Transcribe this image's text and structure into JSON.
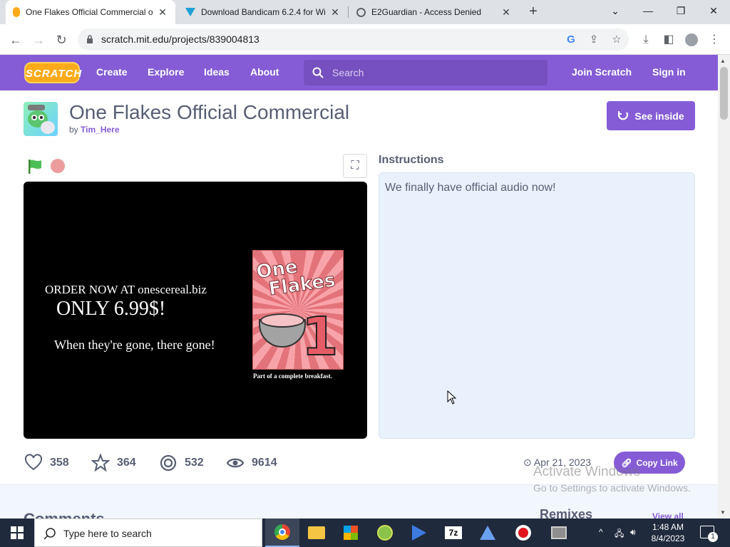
{
  "browser": {
    "tabs": [
      {
        "title": "One Flakes Official Commercial o",
        "active": true
      },
      {
        "title": "Download Bandicam 6.2.4 for Wi",
        "active": false
      },
      {
        "title": "E2Guardian - Access Denied",
        "active": false
      }
    ],
    "url": "scratch.mit.edu/projects/839004813"
  },
  "nav": {
    "logo": "SCRATCH",
    "links": [
      "Create",
      "Explore",
      "Ideas",
      "About"
    ],
    "search_placeholder": "Search",
    "join": "Join Scratch",
    "signin": "Sign in"
  },
  "project": {
    "title": "One Flakes Official Commercial",
    "by_prefix": "by",
    "author": "Tim_Here",
    "see_inside": "See inside",
    "stage": {
      "line1": "ORDER NOW AT onescereal.biz",
      "line2": "ONLY 6.99$!",
      "line3": "When they're gone, there gone!",
      "box_brand_1": "One",
      "box_brand_2": "Flakes",
      "box_number": "1",
      "box_caption": "Part of a complete breakfast."
    },
    "instructions_label": "Instructions",
    "instructions_text": "We finally have official audio now!",
    "stats": {
      "loves": "358",
      "favorites": "364",
      "remixes": "532",
      "views": "9614"
    },
    "date": "Apr 21, 2023",
    "copy_link": "Copy Link",
    "comments_heading": "Comments",
    "remixes_heading": "Remixes",
    "view_all": "View all"
  },
  "watermark": {
    "line1": "Activate Windows",
    "line2": "Go to Settings to activate Windows."
  },
  "taskbar": {
    "search_placeholder": "Type here to search",
    "time": "1:48 AM",
    "date": "8/4/2023",
    "notification_count": "1"
  },
  "colors": {
    "scratch_purple": "#855cd6",
    "text": "#575e75",
    "instructions_bg": "#e9f1fc"
  }
}
